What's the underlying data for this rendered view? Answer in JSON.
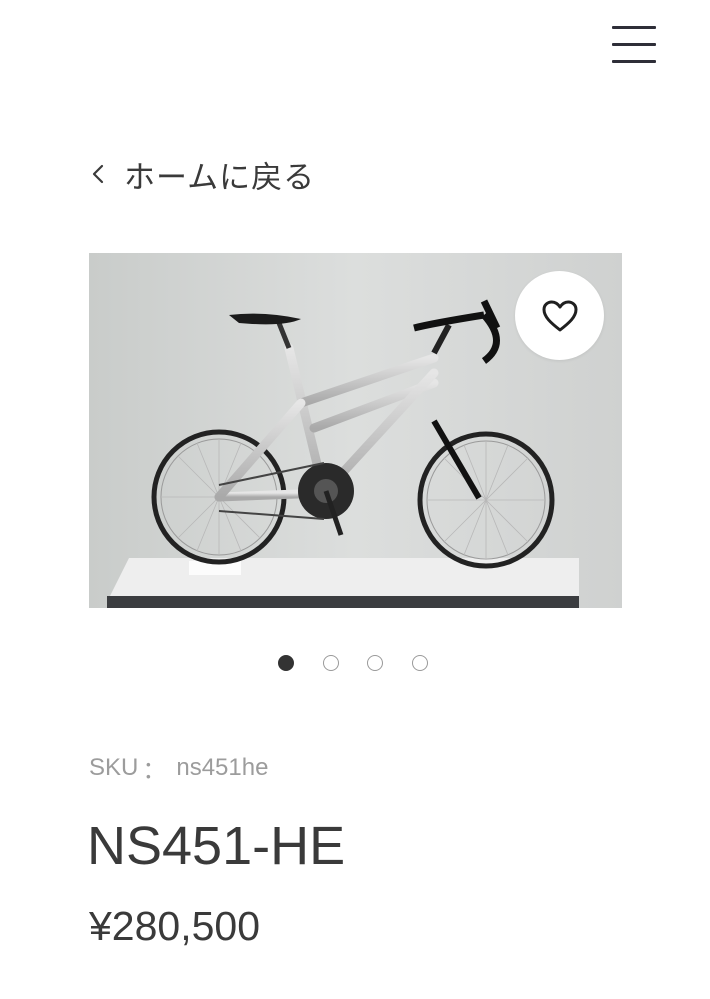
{
  "header": {
    "menu_icon": "hamburger-menu-icon"
  },
  "nav": {
    "back_label": "ホームに戻る",
    "back_icon": "chevron-left-icon"
  },
  "gallery": {
    "image_alt": "silver mini velo road bicycle",
    "favorite_icon": "heart-outline-icon",
    "slide_count": 4,
    "active_slide": 1
  },
  "product": {
    "sku_label": "SKU",
    "sku_separator": "：",
    "sku_value": "ns451he",
    "name": "NS451-HE",
    "price": "¥280,500"
  },
  "colors": {
    "text": "#3a3a3a",
    "muted": "#9c9c9c",
    "accent": "#2e2e38"
  }
}
